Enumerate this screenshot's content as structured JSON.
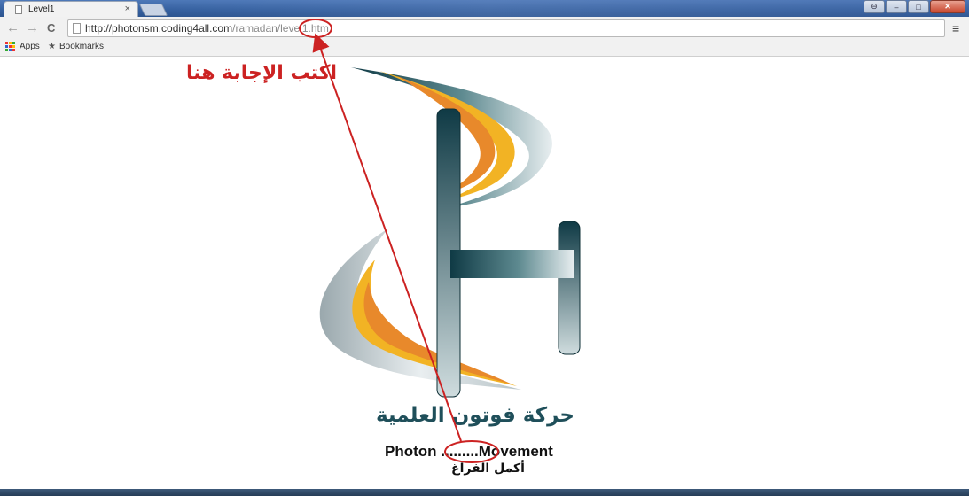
{
  "browser": {
    "tab_title": "Level1",
    "tab_close": "×",
    "url_main": "http://photonsm.coding4all.com",
    "url_rest": "/ramadan/level1.htm",
    "bookmarks": [
      "Apps",
      "Bookmarks"
    ],
    "nav": {
      "back": "←",
      "forward": "→",
      "reload": "C"
    },
    "menu": "≡",
    "window_buttons": {
      "minimize": "–",
      "maximize": "□",
      "close": "✕",
      "extra": "⊖"
    }
  },
  "page": {
    "answer_hint": "اكتب الإجابة هنا",
    "logo_text": "حركة فوتون العلمية",
    "movement_text": "Photon .........Movement",
    "complete_hint": "أكمل الفراغ"
  },
  "colors": {
    "accent_red": "#cc2222",
    "logo_dark": "#1f4f5a",
    "logo_orange": "#f0a020"
  }
}
